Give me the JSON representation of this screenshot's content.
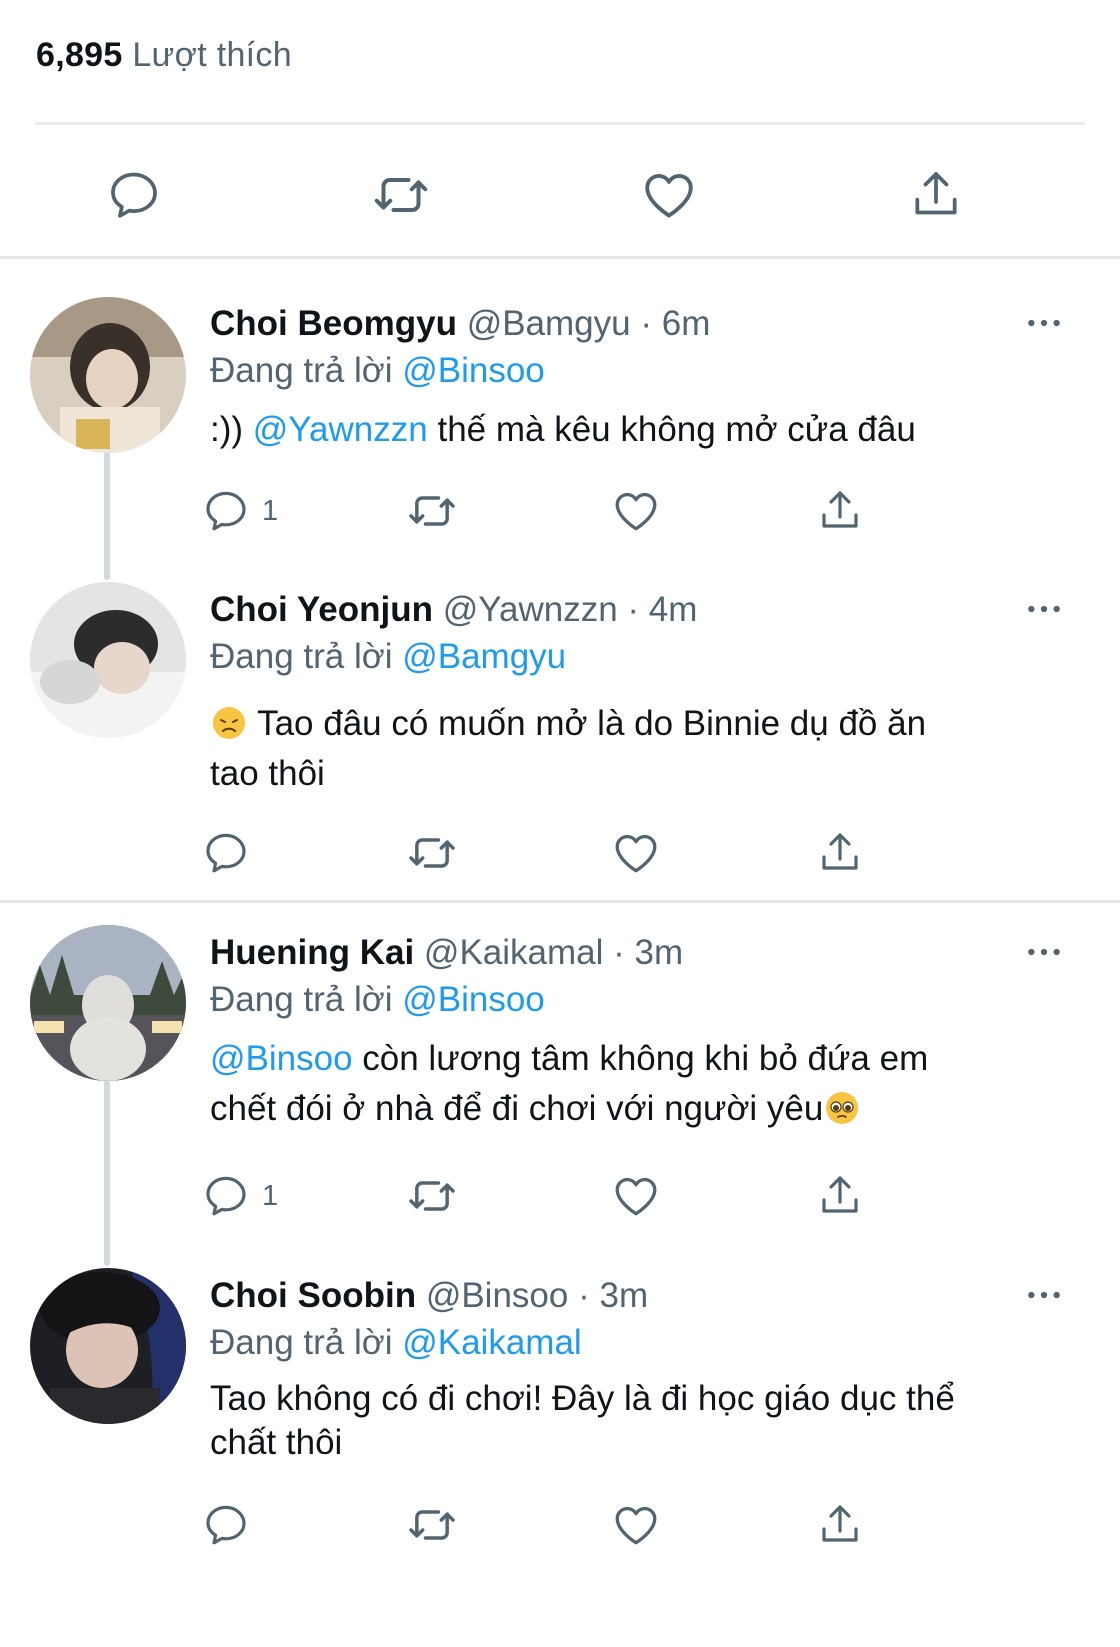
{
  "likes": {
    "count": "6,895",
    "label": "Lượt thích"
  },
  "tweets": [
    {
      "name": "Choi Beomgyu",
      "handle": "@Bamgyu",
      "time": "6m",
      "reply_prefix": "Đang trả lời",
      "reply_to": "@Binsoo",
      "body_pre": ":))",
      "body_mention": "@Yawnzzn",
      "body_text": "thế mà kêu không mở cửa đâu",
      "reply_count": "1",
      "avatar_color": "#b8a48c"
    },
    {
      "name": "Choi Yeonjun",
      "handle": "@Yawnzzn",
      "time": "4m",
      "reply_prefix": "Đang trả lời",
      "reply_to": "@Bamgyu",
      "body_emoji": "disappointed-face",
      "body_text": "Tao đâu có muốn mở là do Binnie dụ đồ ăn",
      "body_text2": "tao thôi",
      "avatar_color": "#c9c9c9"
    },
    {
      "name": "Huening Kai",
      "handle": "@Kaikamal",
      "time": "3m",
      "reply_prefix": "Đang trả lời",
      "reply_to": "@Binsoo",
      "body_mention": "@Binsoo",
      "body_text": "còn lương tâm không khi bỏ đứa em",
      "body_text2": "chết đói ở nhà để đi chơi với người yêu",
      "body_emoji": "pleading-face",
      "reply_count": "1",
      "avatar_color": "#6f7784"
    },
    {
      "name": "Choi Soobin",
      "handle": "@Binsoo",
      "time": "3m",
      "reply_prefix": "Đang trả lời",
      "reply_to": "@Kaikamal",
      "body_text": "Tao không có đi chơi! Đây là đi học giáo dục thể",
      "body_text2": "chất thôi",
      "avatar_color": "#2a2a2e"
    }
  ],
  "icons": {
    "reply": "reply-icon",
    "retweet": "retweet-icon",
    "like": "heart-icon",
    "share": "share-icon",
    "more": "more-dots-icon"
  },
  "colors": {
    "mention": "#1d9bf0",
    "secondary": "#536471",
    "icon": "#536471",
    "divider": "#e6e8ea"
  }
}
